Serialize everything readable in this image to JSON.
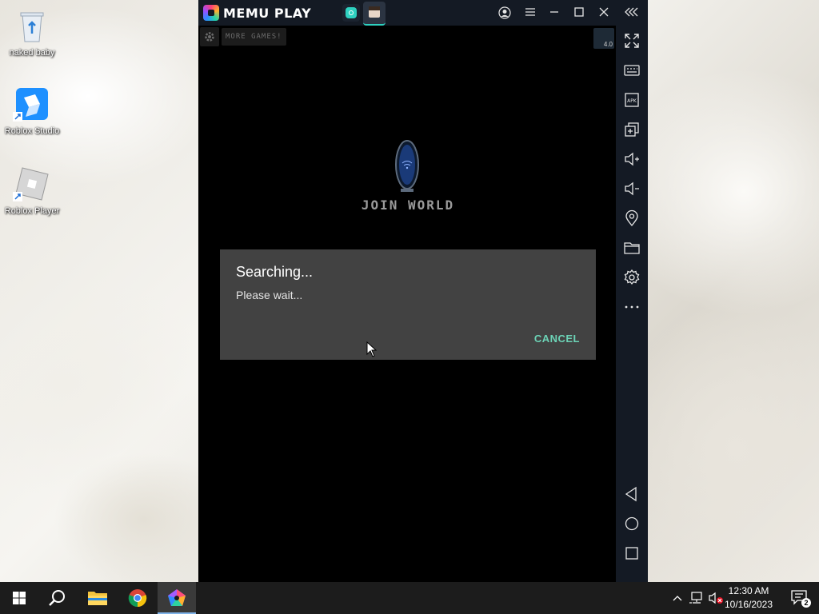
{
  "desktop": {
    "icons": [
      {
        "label": "naked baby"
      },
      {
        "label": "Roblox Studio"
      },
      {
        "label": "Roblox Player"
      }
    ]
  },
  "emulator": {
    "title": "MEMU PLAY",
    "window_buttons": [
      "account-icon",
      "menu-icon",
      "minimize-icon",
      "maximize-icon",
      "close-icon",
      "collapse-sidebar-icon"
    ],
    "sidebar_tools": [
      "fullscreen-icon",
      "keyboard-icon",
      "apk-icon",
      "multi-instance-icon",
      "volume-up-icon",
      "volume-down-icon",
      "location-icon",
      "folder-icon",
      "settings-icon",
      "more-icon"
    ],
    "nav_buttons": [
      "back-icon",
      "home-icon",
      "recents-icon"
    ],
    "accent": "#2ed1c0"
  },
  "game": {
    "more_games_label": "MORE GAMES!",
    "thumb_badge": "4.0",
    "join_world_label": "JOIN WORLD"
  },
  "dialog": {
    "title": "Searching...",
    "message": "Please wait...",
    "cancel_label": "CANCEL",
    "accent": "#6cd3b6"
  },
  "taskbar": {
    "time": "12:30 AM",
    "date": "10/16/2023",
    "notification_count": "2",
    "pinned": [
      "start-icon",
      "search-icon",
      "file-explorer-icon",
      "chrome-icon",
      "memu-icon"
    ]
  }
}
